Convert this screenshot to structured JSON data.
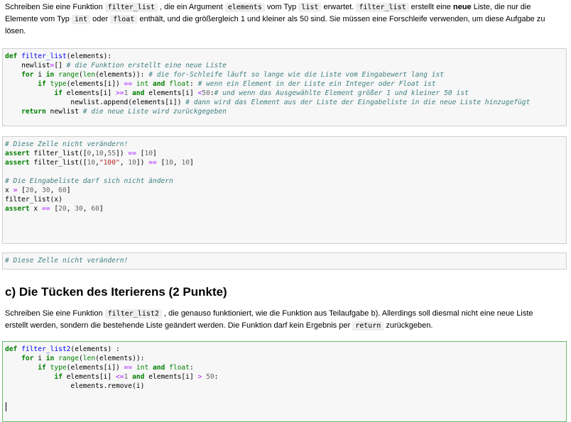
{
  "intro": {
    "t1": "Schreiben Sie eine Funktion",
    "c1": "filter_list",
    "t2": ", die ein Argument",
    "c2": "elements",
    "t3": "vom Typ",
    "c3": "list",
    "t4": "erwartet.",
    "c4": "filter_list",
    "t5": "erstellt eine",
    "b1": "neue",
    "t6": "Liste, die nur die",
    "t7": "Elemente vom Typ",
    "c5": "int",
    "t8": "oder",
    "c6": "float",
    "t9": "enthält, und die größergleich 1 und kleiner als 50 sind. Sie müssen eine Forschleife verwenden, um diese Aufgabe zu",
    "t10": "lösen."
  },
  "cell1": {
    "l1_kw": "def",
    "l1_fn": "filter_list",
    "l1_rest": "(elements):",
    "l2_a": "    newlist",
    "l2_op": "=",
    "l2_b": "[] ",
    "l2_cm": "# die Funktion erstellt eine neue Liste",
    "l3_kw1": "for",
    "l3_a": " i ",
    "l3_kw2": "in",
    "l3_bi1": "range",
    "l3_b": "(",
    "l3_bi2": "len",
    "l3_c": "(elements)): ",
    "l3_cm": "# die for-Schleife läuft so lange wie die Liste vom Eingabewert lang ist",
    "l4_kw1": "if",
    "l4_bi1": "type",
    "l4_a": "(elements[i]) ",
    "l4_op": "==",
    "l4_bi2": "int",
    "l4_kw2": "and",
    "l4_bi3": "float",
    "l4_b": ": ",
    "l4_cm": "# wenn ein Element in der Liste ein Integer oder Float ist",
    "l5_kw1": "if",
    "l5_a": " elements[i] ",
    "l5_op1": ">=",
    "l5_nm1": "1",
    "l5_kw2": "and",
    "l5_b": " elements[i] ",
    "l5_op2": "<",
    "l5_nm2": "50",
    "l5_c": ":",
    "l5_cm": "# und wenn das Ausgewählte Element größer 1 und kleiner 50 ist",
    "l6_a": "                newlist.append(elements[i]) ",
    "l6_cm": "# dann wird das Element aus der Liste der Eingabeliste in die neue Liste hinzugefügt",
    "l7_kw": "return",
    "l7_a": " newlist ",
    "l7_cm": "# die neue Liste wird zurückgegeben"
  },
  "cell2": {
    "l1_cm": "# Diese Zelle nicht verändern!",
    "l2_kw": "assert",
    "l2_a": " filter_list([",
    "l2_nm1": "0",
    "l2_nm2": "10",
    "l2_nm3": "55",
    "l2_b": "]) ",
    "l2_op": "==",
    "l2_nm4": "10",
    "l3_kw": "assert",
    "l3_a": " filter_list([",
    "l3_nm1": "10",
    "l3_st": "\"100\"",
    "l3_nm2": "10",
    "l3_b": "]) ",
    "l3_op": "==",
    "l3_nm3": "10",
    "l3_nm4": "10",
    "l5_cm": "# Die Eingabeliste darf sich nicht ändern",
    "l6_a": "x ",
    "l6_op": "=",
    "l6_nm1": "20",
    "l6_nm2": "30",
    "l6_nm3": "60",
    "l7": "filter_list(x)",
    "l8_kw": "assert",
    "l8_a": " x ",
    "l8_op": "==",
    "l8_nm1": "20",
    "l8_nm2": "30",
    "l8_nm3": "60"
  },
  "cell3": {
    "l1_cm": "# Diese Zelle nicht verändern!"
  },
  "section": {
    "heading": "c) Die Tücken des Iterierens (2 Punkte)",
    "t1": "Schreiben Sie eine Funktion",
    "c1": "filter_list2",
    "t2": ", die genauso funktioniert, wie die Funktion aus Teilaufgabe b). Allerdings soll diesmal nicht eine neue Liste",
    "t3": "erstellt werden, sondern die bestehende Liste geändert werden. Die Funktion darf kein Ergebnis per",
    "c2": "return",
    "t4": "zurückgeben."
  },
  "cell4": {
    "l1_kw": "def",
    "l1_fn": "filter_list2",
    "l1_rest": "(elements) :",
    "l2_kw1": "for",
    "l2_a": " i ",
    "l2_kw2": "in",
    "l2_bi1": "range",
    "l2_b": "(",
    "l2_bi2": "len",
    "l2_c": "(elements)):",
    "l3_kw1": "if",
    "l3_bi1": "type",
    "l3_a": "(elements[i]) ",
    "l3_op": "==",
    "l3_bi2": "int",
    "l3_kw2": "and",
    "l3_bi3": "float",
    "l3_b": ":",
    "l4_kw1": "if",
    "l4_a": " elements[i] ",
    "l4_op1": "<=",
    "l4_nm1": "1",
    "l4_kw2": "and",
    "l4_b": " elements[i] ",
    "l4_op2": ">",
    "l4_nm2": "50",
    "l4_c": ":",
    "l5": "                elements.remove(i)"
  }
}
